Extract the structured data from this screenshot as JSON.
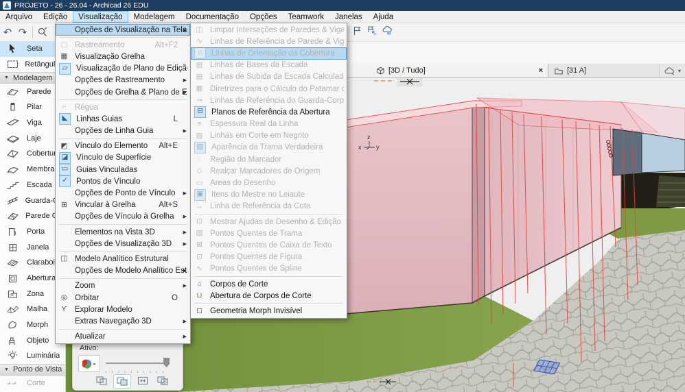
{
  "window": {
    "title": "PROJETO - 26 - 26.04 - Archicad 26 EDU"
  },
  "menu_bar": {
    "items": [
      {
        "label": "Arquivo"
      },
      {
        "label": "Edição"
      },
      {
        "label": "Visualização",
        "active": true
      },
      {
        "label": "Modelagem"
      },
      {
        "label": "Documentação"
      },
      {
        "label": "Opções"
      },
      {
        "label": "Teamwork"
      },
      {
        "label": "Janelas"
      },
      {
        "label": "Ajuda"
      }
    ]
  },
  "toolbar": {
    "left_icons": [
      "undo-icon",
      "redo-icon",
      "zoom-tool-icon"
    ],
    "right_icons": [
      "flag-icon",
      "flag-elements-icon",
      "cloud-object-icon"
    ]
  },
  "view_menu": {
    "items": [
      {
        "label": "Opções de Visualização na Tela",
        "submenu": true,
        "state": "highlighted",
        "sep_after": true
      },
      {
        "label": "Rastreamento",
        "shortcut": "Alt+F2",
        "state": "disabled",
        "icon": "trace"
      },
      {
        "label": "Visualização Grelha",
        "icon": "grid-view"
      },
      {
        "label": "Visualização de Plano de Edição",
        "icon": "editing-plane",
        "icon_on": true
      },
      {
        "label": "Opções de Rastreamento",
        "submenu": true
      },
      {
        "label": "Opções de Grelha & Plano de Edição",
        "submenu": true,
        "sep_after": true
      },
      {
        "label": "Régua",
        "state": "disabled",
        "icon": "ruler"
      },
      {
        "label": "Linhas Guias",
        "shortcut": "L",
        "icon": "guide-lines",
        "icon_on": true
      },
      {
        "label": "Opções de Linha Guia",
        "submenu": true,
        "sep_after": true
      },
      {
        "label": "Vínculo do Elemento",
        "shortcut": "Alt+E",
        "icon": "element-snap"
      },
      {
        "label": "Vínculo de Superfície",
        "icon": "surface-snap",
        "icon_on": true
      },
      {
        "label": "Guias Vinculadas",
        "icon": "snap-guides",
        "icon_on": true
      },
      {
        "label": "Pontos de Vínculo",
        "icon": "snap-points",
        "icon_on": true
      },
      {
        "label": "Opções de Ponto de Vínculo",
        "submenu": true
      },
      {
        "label": "Vincular à Grelha",
        "shortcut": "Alt+S",
        "icon": "grid-snap"
      },
      {
        "label": "Opções de Vínculo à Grelha",
        "submenu": true,
        "sep_after": true
      },
      {
        "label": "Elementos na Vista 3D",
        "submenu": true
      },
      {
        "label": "Opções de Visualização 3D",
        "submenu": true,
        "sep_after": true
      },
      {
        "label": "Modelo Analítico Estrutural",
        "icon": "structural-model"
      },
      {
        "label": "Opções de Modelo Analítico Estrutural",
        "submenu": true,
        "sep_after": true
      },
      {
        "label": "Zoom",
        "submenu": true
      },
      {
        "label": "Orbitar",
        "shortcut": "O",
        "icon": "orbit"
      },
      {
        "label": "Explorar Modelo",
        "icon": "explore-model"
      },
      {
        "label": "Extras Navegação 3D",
        "submenu": true,
        "sep_after": true
      },
      {
        "label": "Atualizar",
        "submenu": true
      }
    ]
  },
  "screen_options_submenu": {
    "items": [
      {
        "label": "Limpar Interseções de Paredes & Vigas",
        "state": "disabled",
        "icon": "wall-beam-intersection"
      },
      {
        "label": "Linhas de Referência de Parede & Viga",
        "state": "disabled",
        "icon": "wall-beam-reference"
      },
      {
        "label": "Linhas de Orientação da Cobertura",
        "state": "disabled",
        "highlighted": true,
        "icon": "roof-pitch-lines",
        "icon_on": true
      },
      {
        "label": "Linhas de Bases da Escada",
        "state": "disabled",
        "icon": "stair-base-lines"
      },
      {
        "label": "Linhas de Subida da Escada Calculada",
        "state": "disabled",
        "icon": "stair-walking-line"
      },
      {
        "label": "Diretrizes para o Cálculo do Patamar da Escada",
        "state": "disabled",
        "icon": "stair-landing-guides"
      },
      {
        "label": "Linhas de Referência do Guarda-Corpo",
        "state": "disabled",
        "icon": "railing-reference"
      },
      {
        "label": "Planos de Referência da Abertura",
        "icon": "opening-reference",
        "icon_on": true
      },
      {
        "label": "Espessura Real da Linha",
        "state": "disabled",
        "icon": "true-line-weight"
      },
      {
        "label": "Linhas em Corte em Negrito",
        "state": "disabled",
        "icon": "bold-cut-lines"
      },
      {
        "label": "Aparência da Trama Verdadeira",
        "state": "disabled",
        "icon": "vectorial-hatching",
        "icon_on": true
      },
      {
        "label": "Região do Marcador",
        "state": "disabled",
        "icon": "marker-range"
      },
      {
        "label": "Realçar Marcadores de Origem",
        "state": "disabled",
        "icon": "source-markers"
      },
      {
        "label": "Áreas do Desenho",
        "state": "disabled",
        "icon": "drawing-frames"
      },
      {
        "label": "Itens do Mestre no Leiaute",
        "state": "disabled",
        "icon": "master-layout-items",
        "icon_on": true
      },
      {
        "label": "Linha de Referência da Cota",
        "state": "disabled",
        "icon": "dimension-reference",
        "sep_after": true
      },
      {
        "label": "Mostrar Ajudas de Desenho & Edição",
        "state": "disabled",
        "icon": "editing-helpers"
      },
      {
        "label": "Pontos Quentes de Trama",
        "state": "disabled",
        "icon": "fill-hotspots"
      },
      {
        "label": "Pontos Quentes de Caixa de Texto",
        "state": "disabled",
        "icon": "textbox-hotspots"
      },
      {
        "label": "Pontos Quentes de Figura",
        "state": "disabled",
        "icon": "figure-hotspots"
      },
      {
        "label": "Pontos Quentes de Spline",
        "state": "disabled",
        "icon": "spline-hotspots",
        "sep_after": true
      },
      {
        "label": "Corpos de Corte",
        "icon": "cutting-bodies"
      },
      {
        "label": "Abertura de Corpos de Corte",
        "icon": "cutting-body-openings",
        "sep_after": true
      },
      {
        "label": "Geometria Morph Invisível",
        "icon": "invisible-morph-geometry"
      }
    ]
  },
  "toolbox": {
    "items": [
      {
        "type": "tool",
        "label": "Seta",
        "icon": "arrow",
        "selected": true
      },
      {
        "type": "tool",
        "label": "Retângulo de",
        "icon": "marquee"
      },
      {
        "type": "header",
        "label": "Modelagem"
      },
      {
        "type": "tool",
        "label": "Parede",
        "icon": "wall"
      },
      {
        "type": "tool",
        "label": "Pilar",
        "icon": "column"
      },
      {
        "type": "tool",
        "label": "Viga",
        "icon": "beam"
      },
      {
        "type": "tool",
        "label": "Laje",
        "icon": "slab"
      },
      {
        "type": "tool",
        "label": "Cobertura",
        "icon": "roof"
      },
      {
        "type": "tool",
        "label": "Membrana",
        "icon": "shell"
      },
      {
        "type": "tool",
        "label": "Escada",
        "icon": "stair"
      },
      {
        "type": "tool",
        "label": "Guarda-Corp",
        "icon": "railing"
      },
      {
        "type": "tool",
        "label": "Parede Corti",
        "icon": "curtain-wall"
      },
      {
        "type": "tool",
        "label": "Porta",
        "icon": "door"
      },
      {
        "type": "tool",
        "label": "Janela",
        "icon": "window"
      },
      {
        "type": "tool",
        "label": "Claraboia",
        "icon": "skylight"
      },
      {
        "type": "tool",
        "label": "Abertura",
        "icon": "opening"
      },
      {
        "type": "tool",
        "label": "Zona",
        "icon": "zone"
      },
      {
        "type": "tool",
        "label": "Malha",
        "icon": "mesh"
      },
      {
        "type": "tool",
        "label": "Morph",
        "icon": "morph"
      },
      {
        "type": "tool",
        "label": "Objeto",
        "icon": "object"
      },
      {
        "type": "tool",
        "label": "Luminária",
        "icon": "lamp"
      },
      {
        "type": "header",
        "label": "Ponto de Vista"
      },
      {
        "type": "tool",
        "label": "Corte",
        "icon": "section",
        "disabled": true
      }
    ]
  },
  "tabs": {
    "items": [
      {
        "label": "[3D / Tudo]",
        "icon": "cube-3d",
        "active": true,
        "closable": true
      },
      {
        "label": "[31 A]",
        "icon": "layout-folder"
      }
    ],
    "right_icons": [
      "cloud-icon",
      "dropdown-caret-icon"
    ]
  },
  "palette": {
    "active_label": "Ativo:",
    "icons": [
      "ghost-compare-icon",
      "overlap-compare-icon",
      "swap-compare-icon",
      "hatch-compare-icon"
    ]
  },
  "viewport": {
    "axis": {
      "x": "x",
      "y": "y",
      "z": "z"
    }
  },
  "colors": {
    "menu_highlight": "#b7d9f2",
    "menu_highlight_border": "#5d9fd4",
    "accent_blue": "#2f7fd0",
    "building_pink": "#e9c6cb",
    "grass_green": "#7d9a42",
    "reference_red": "#e2453a",
    "titlebar_blue": "#1d3e60"
  }
}
